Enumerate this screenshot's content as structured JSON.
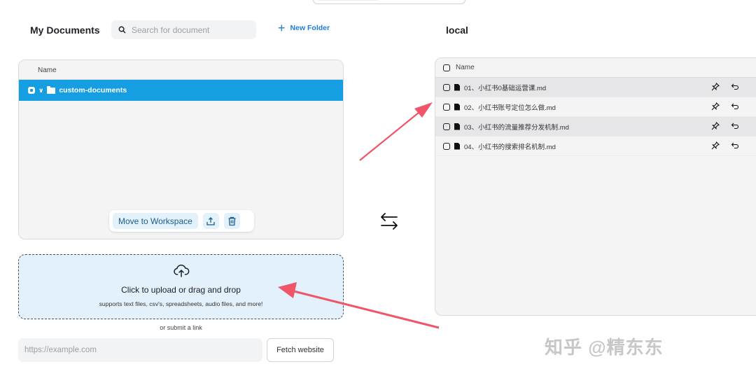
{
  "left_panel": {
    "title": "My Documents",
    "search_placeholder": "Search for document",
    "new_folder_label": "New Folder",
    "column_header": "Name",
    "folder": {
      "name": "custom-documents",
      "selected": true,
      "expanded": true
    },
    "actions": {
      "move_label": "Move to Workspace",
      "upload_icon": "upload-tray-icon",
      "delete_icon": "trash-icon"
    }
  },
  "upload": {
    "title": "Click to upload or drag and drop",
    "subtitle": "supports text files, csv's, spreadsheets, audio files, and more!",
    "or_link": "or submit a link",
    "url_placeholder": "https://example.com",
    "fetch_label": "Fetch website"
  },
  "swap_icon": "swap-arrows-icon",
  "right_panel": {
    "title": "local",
    "column_header": "Name",
    "files": [
      {
        "name": "01、小红书0基础运营课.md"
      },
      {
        "name": "02、小红书账号定位怎么做.md"
      },
      {
        "name": "03、小红书的流量推荐分发机制.md"
      },
      {
        "name": "04、小红书的搜索排名机制.md"
      }
    ]
  },
  "watermark": "知乎 @精东东",
  "colors": {
    "accent": "#169ee2",
    "arrow": "#f0566a",
    "dropzone": "#e3f1fc"
  }
}
